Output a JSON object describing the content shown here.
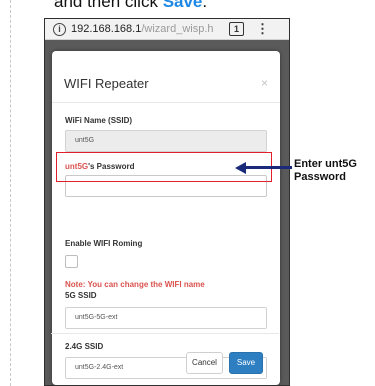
{
  "instruction": {
    "prefix": "and then click ",
    "emphasis": "Save",
    "suffix": "."
  },
  "browser": {
    "url_host": "192.168.168.1",
    "url_path": "/wizard_wisp.h",
    "tab_count": "1",
    "menu_glyph": "⋮",
    "info_glyph": "i"
  },
  "modal": {
    "title": "WIFI Repeater",
    "close_glyph": "×",
    "wifi_name_label": "WiFi Name (SSID)",
    "wifi_name_value": "unt5G",
    "password_label_ssid": "unt5G",
    "password_label_suffix": "'s Password",
    "password_value": "",
    "enable_roaming_label": "Enable WIFI Roming",
    "note": "Note: You can change the WIFI name",
    "ssid_5g_label": "5G SSID",
    "ssid_5g_value": "unt5G-5G-ext",
    "ssid_24g_label": "2.4G SSID",
    "ssid_24g_value": "unt5G-2.4G-ext",
    "cancel_label": "Cancel",
    "save_label": "Save"
  },
  "callout": {
    "line1": "Enter unt5G",
    "line2": "Password"
  },
  "colors": {
    "accent": "#2e7fc2",
    "highlight": "#e0202a",
    "arrow": "#1a2a7a",
    "label_red": "#d9534f"
  }
}
